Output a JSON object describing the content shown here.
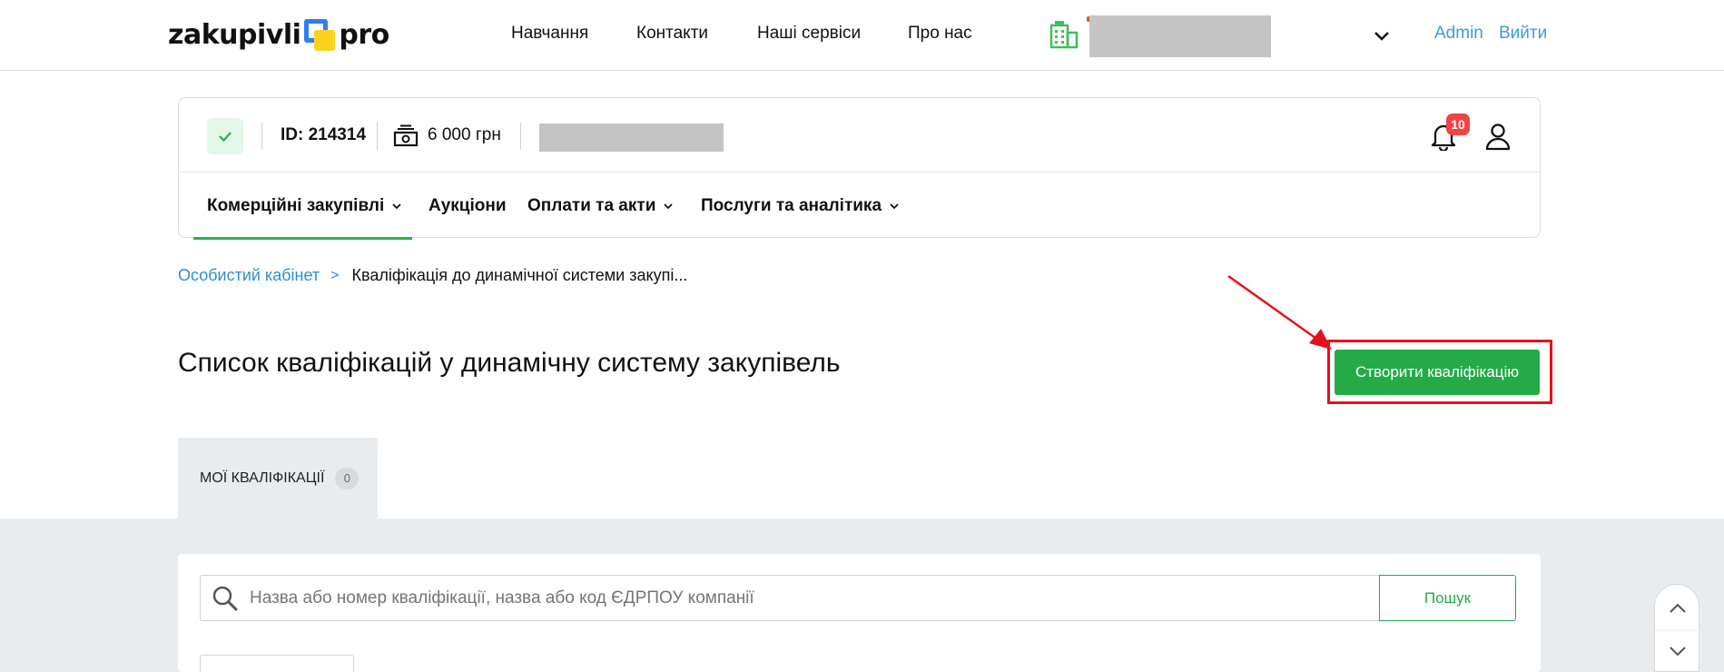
{
  "header": {
    "logo_left": "zakupivli",
    "logo_right": "pro",
    "nav": [
      "Навчання",
      "Контакти",
      "Наші сервіси",
      "Про нас"
    ],
    "admin_label": "Admin",
    "logout_label": "Вийти"
  },
  "account": {
    "id_label": "ID: 214314",
    "balance": "6 000 грн",
    "notifications_count": "10",
    "menu": [
      {
        "label": "Комерційні закупівлі",
        "has_dropdown": true
      },
      {
        "label": "Аукціони",
        "has_dropdown": false
      },
      {
        "label": "Оплати та акти",
        "has_dropdown": true
      },
      {
        "label": "Послуги та аналітика",
        "has_dropdown": true
      }
    ]
  },
  "breadcrumb": {
    "home": "Особистий кабінет",
    "separator": ">",
    "current": "Кваліфікація до динамічної системи закупі..."
  },
  "page": {
    "title": "Список кваліфікацій у динамічну систему закупівель",
    "create_button": "Створити кваліфікацію"
  },
  "tabs": [
    {
      "label": "МОЇ КВАЛІФІКАЦІЇ",
      "count": "0"
    }
  ],
  "search": {
    "placeholder": "Назва або номер кваліфікації, назва або код ЄДРПОУ компанії",
    "value": "",
    "button": "Пошук"
  },
  "colors": {
    "accent_green": "#24ab48",
    "link_blue": "#2d8fcf",
    "annotation_red": "#e8101b",
    "badge_red": "#f04444"
  },
  "icons": [
    "building-icon",
    "chevron-down-icon",
    "check-icon",
    "money-icon",
    "bell-icon",
    "user-icon",
    "search-icon",
    "chevron-up-icon"
  ]
}
